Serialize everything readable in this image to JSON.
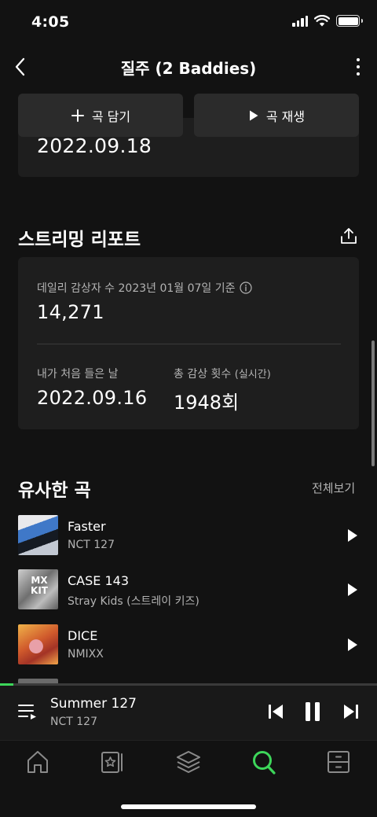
{
  "status_bar": {
    "time": "4:05"
  },
  "header": {
    "title": "질주 (2 Baddies)"
  },
  "actions": {
    "add_label": "곡 담기",
    "play_label": "곡 재생"
  },
  "previous_card": {
    "value": "2022.09.18"
  },
  "streaming_report": {
    "title": "스트리밍 리포트",
    "daily_listeners_label": "데일리 감상자 수 2023년 01월 07일 기준",
    "daily_listeners_value": "14,271",
    "first_listen_label": "내가 처음 들은 날",
    "first_listen_value": "2022.09.16",
    "total_plays_label": "총 감상 횟수",
    "total_plays_sublabel": "(실시간)",
    "total_plays_value": "1948회"
  },
  "similar_songs": {
    "title": "유사한 곡",
    "see_all": "전체보기",
    "items": [
      {
        "title": "Faster",
        "artist": "NCT 127"
      },
      {
        "title": "CASE 143",
        "artist": "Stray Kids (스트레이 키즈)",
        "cover_text": "MX\nKIT"
      },
      {
        "title": "DICE",
        "artist": "NMIXX"
      }
    ]
  },
  "now_playing": {
    "title": "Summer 127",
    "artist": "NCT 127",
    "progress": 0.035
  },
  "nav": {
    "items": [
      "home-icon",
      "library-icon",
      "layers-icon",
      "search-icon",
      "storage-icon"
    ],
    "active": "search-icon",
    "active_color": "#3dd65a"
  },
  "colors": {
    "background": "#121212",
    "card": "#1e1e1e",
    "button": "#2b2b2b",
    "accent": "#3dd65a",
    "secondary_text": "#b3b3b3"
  }
}
